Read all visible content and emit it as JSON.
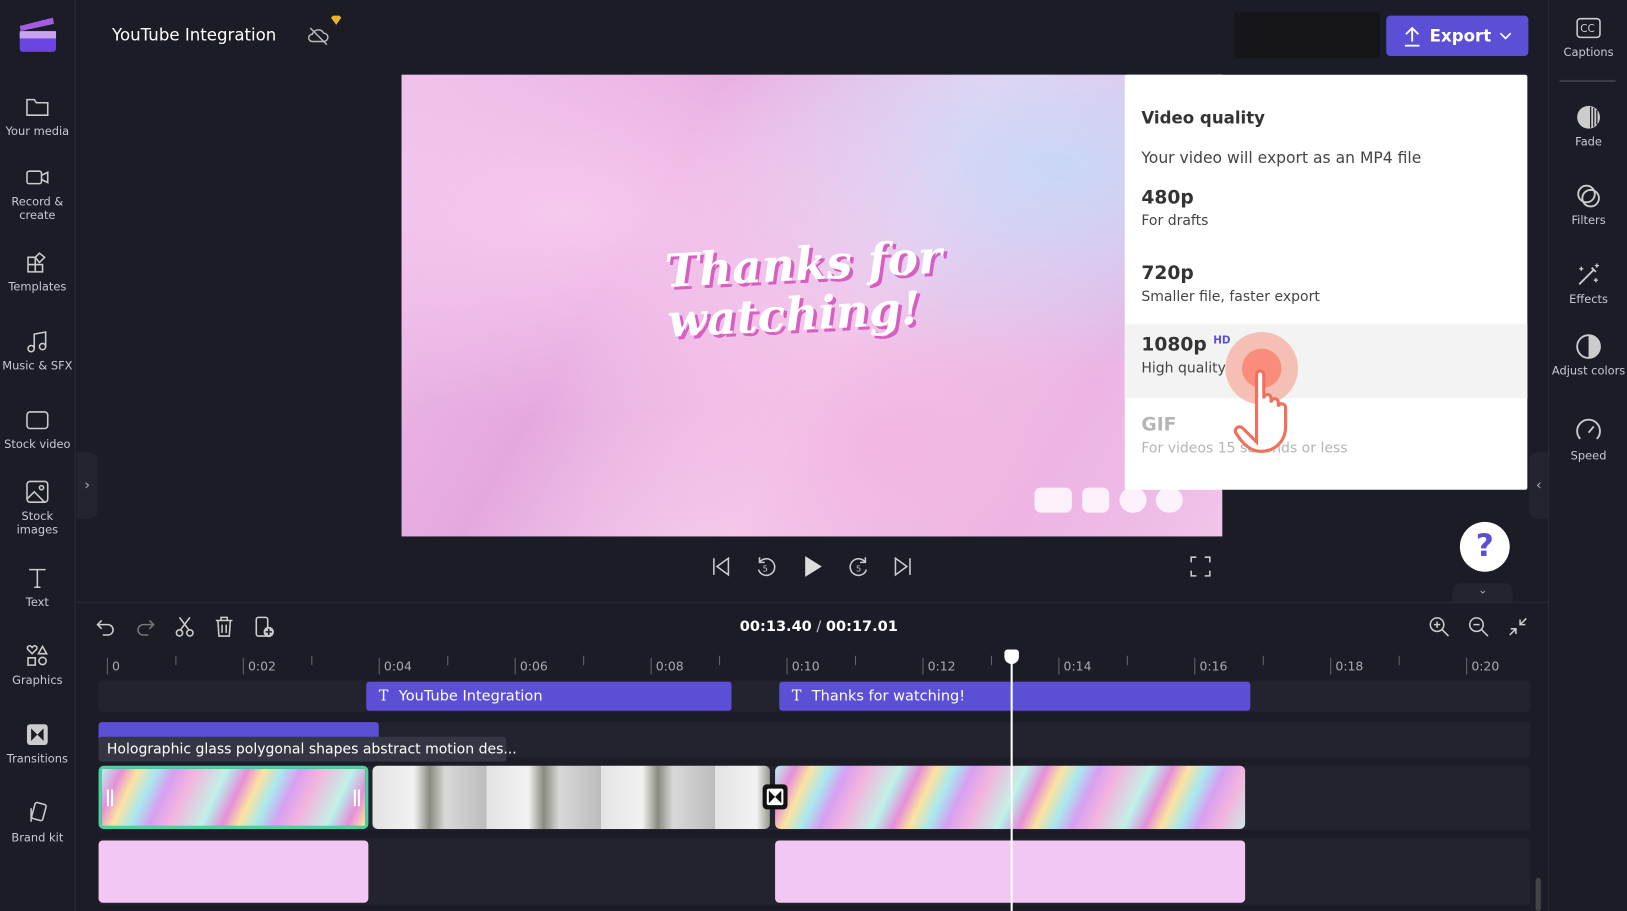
{
  "header": {
    "project_title": "YouTube Integration",
    "export_label": "Export"
  },
  "sidebar": {
    "items": [
      {
        "label": "Your media",
        "icon": "folder-icon"
      },
      {
        "label": "Record & create",
        "icon": "camera-icon"
      },
      {
        "label": "Templates",
        "icon": "templates-icon"
      },
      {
        "label": "Music & SFX",
        "icon": "music-icon"
      },
      {
        "label": "Stock video",
        "icon": "film-icon"
      },
      {
        "label": "Stock images",
        "icon": "image-icon"
      },
      {
        "label": "Text",
        "icon": "text-icon"
      },
      {
        "label": "Graphics",
        "icon": "shapes-icon"
      },
      {
        "label": "Transitions",
        "icon": "transition-icon"
      },
      {
        "label": "Brand kit",
        "icon": "brand-icon"
      }
    ]
  },
  "right_panel": {
    "items": [
      {
        "label": "Captions",
        "icon": "cc-icon"
      },
      {
        "label": "Fade",
        "icon": "fade-icon"
      },
      {
        "label": "Filters",
        "icon": "filters-icon"
      },
      {
        "label": "Effects",
        "icon": "wand-icon"
      },
      {
        "label": "Adjust colors",
        "icon": "contrast-icon"
      },
      {
        "label": "Speed",
        "icon": "speedometer-icon"
      }
    ]
  },
  "preview": {
    "overlay_text": "Thanks for watching!"
  },
  "export_menu": {
    "heading": "Video quality",
    "subtitle": "Your video will export as an MP4 file",
    "options": [
      {
        "name": "480p",
        "desc": "For drafts"
      },
      {
        "name": "720p",
        "desc": "Smaller file, faster export"
      },
      {
        "name": "1080p",
        "badge": "HD",
        "desc": "High quality",
        "selected": true
      },
      {
        "name": "GIF",
        "desc": "For videos 15 seconds or less",
        "disabled": true
      }
    ]
  },
  "player": {
    "current_time": "00:13.40",
    "separator": " / ",
    "total_time": "00:17.01"
  },
  "timeline": {
    "ruler": [
      "0",
      "0:02",
      "0:04",
      "0:06",
      "0:08",
      "0:10",
      "0:12",
      "0:14",
      "0:16",
      "0:18",
      "0:20"
    ],
    "text_clips": [
      "YouTube Integration",
      "Thanks for watching!"
    ],
    "tooltip": "Holographic glass polygonal shapes abstract motion des...",
    "playhead_seconds": 13.4
  },
  "colors": {
    "accent": "#5b4fd6",
    "background": "#1b1c26",
    "selected_clip_border": "#4fd0a0",
    "audio_clip": "#f3c7f4"
  }
}
